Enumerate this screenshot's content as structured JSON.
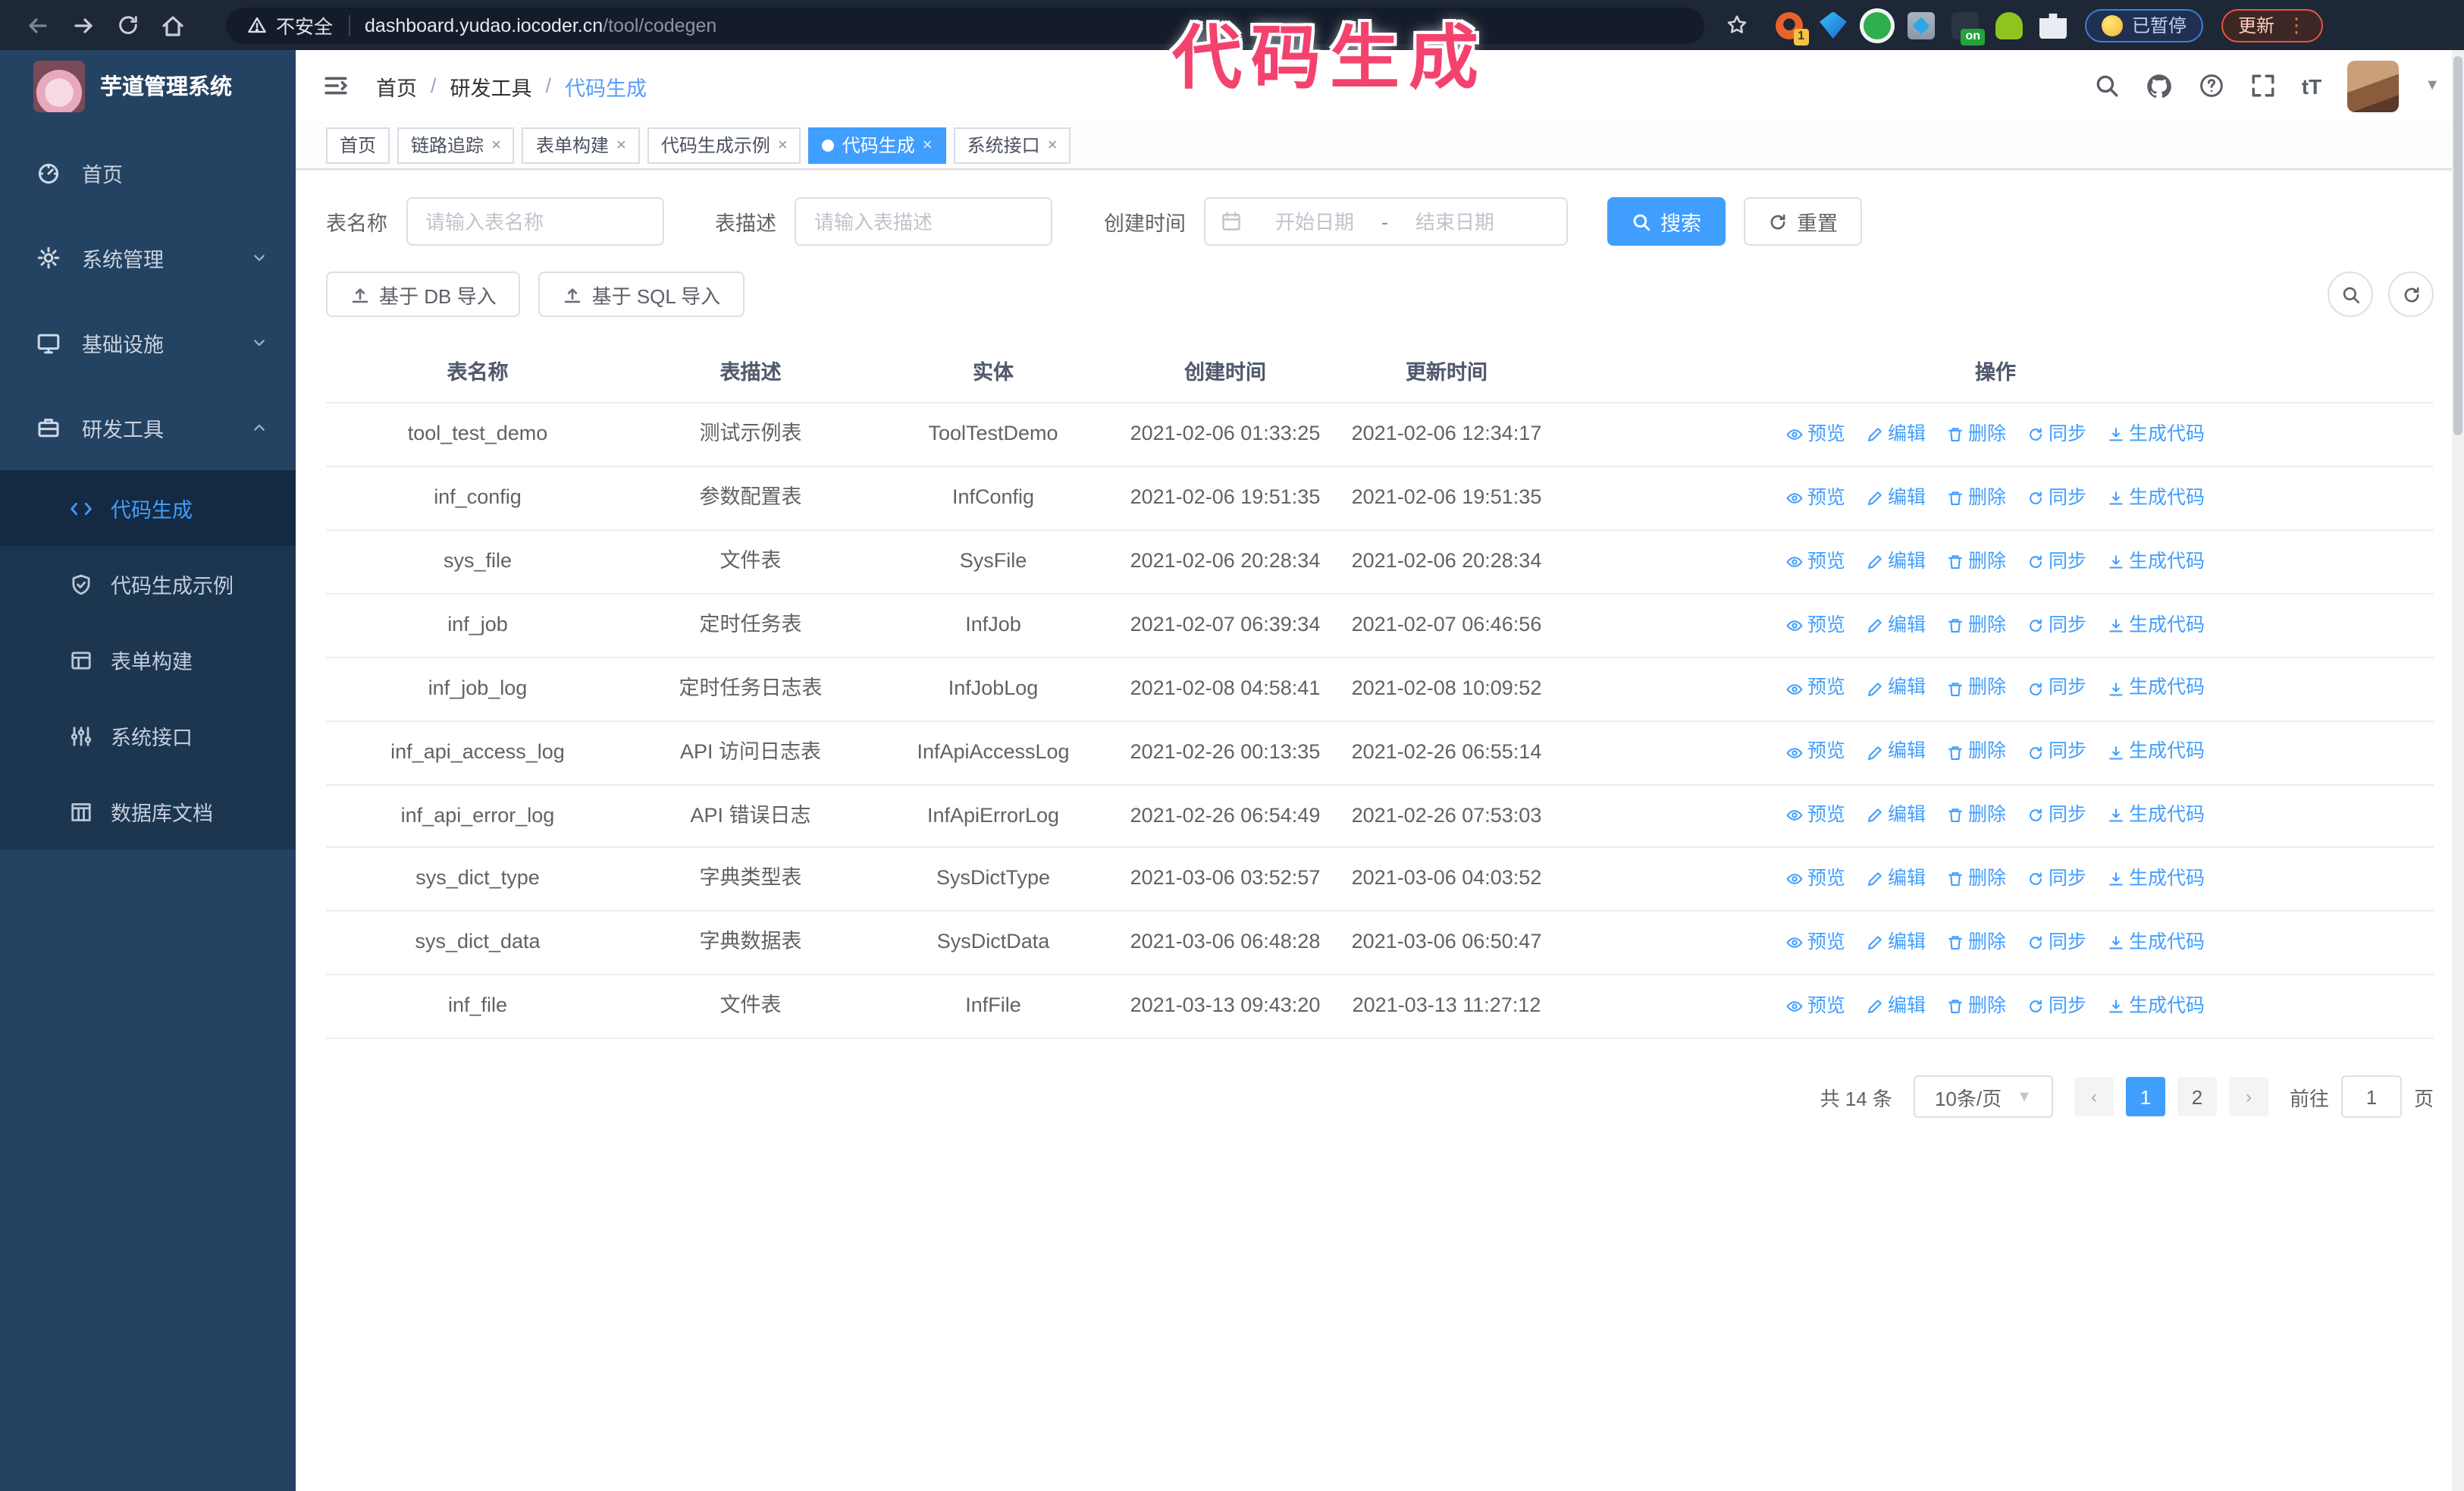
{
  "browser": {
    "security_label": "不安全",
    "url_host": "dashboard.yudao.iocoder.cn",
    "url_path": "/tool/codegen",
    "extensions": [
      {
        "badge": "1"
      },
      {
        "badge": ""
      },
      {
        "badge": ""
      },
      {
        "badge": ""
      },
      {
        "badge": "on"
      },
      {
        "badge": ""
      },
      {
        "badge": ""
      }
    ],
    "paused_button": "已暂停",
    "update_button": "更新"
  },
  "annotation": {
    "text": "代码生成"
  },
  "sidebar": {
    "title": "芋道管理系统",
    "items": [
      {
        "label": "首页",
        "icon": "dashboard-icon",
        "chevron": ""
      },
      {
        "label": "系统管理",
        "icon": "gear-icon",
        "chevron": "down"
      },
      {
        "label": "基础设施",
        "icon": "monitor-icon",
        "chevron": "down"
      },
      {
        "label": "研发工具",
        "icon": "toolbox-icon",
        "chevron": "up"
      }
    ],
    "submenu": [
      {
        "label": "代码生成",
        "icon": "code-icon",
        "active": true
      },
      {
        "label": "代码生成示例",
        "icon": "shield-check-icon",
        "active": false
      },
      {
        "label": "表单构建",
        "icon": "form-icon",
        "active": false
      },
      {
        "label": "系统接口",
        "icon": "sliders-icon",
        "active": false
      },
      {
        "label": "数据库文档",
        "icon": "columns-icon",
        "active": false
      }
    ]
  },
  "header": {
    "breadcrumb": [
      "首页",
      "研发工具",
      "代码生成"
    ]
  },
  "tabs": [
    {
      "label": "首页",
      "closable": false,
      "active": false
    },
    {
      "label": "链路追踪",
      "closable": true,
      "active": false
    },
    {
      "label": "表单构建",
      "closable": true,
      "active": false
    },
    {
      "label": "代码生成示例",
      "closable": true,
      "active": false
    },
    {
      "label": "代码生成",
      "closable": true,
      "active": true
    },
    {
      "label": "系统接口",
      "closable": true,
      "active": false
    }
  ],
  "filters": {
    "table_name_label": "表名称",
    "table_name_placeholder": "请输入表名称",
    "table_desc_label": "表描述",
    "table_desc_placeholder": "请输入表描述",
    "create_time_label": "创建时间",
    "date_start_placeholder": "开始日期",
    "date_separator": "-",
    "date_end_placeholder": "结束日期",
    "search_label": "搜索",
    "reset_label": "重置"
  },
  "toolbar": {
    "import_db_label": "基于 DB 导入",
    "import_sql_label": "基于 SQL 导入"
  },
  "table": {
    "columns": [
      "表名称",
      "表描述",
      "实体",
      "创建时间",
      "更新时间",
      "操作"
    ],
    "actions": [
      {
        "label": "预览",
        "icon": "eye-icon",
        "name": "preview-link"
      },
      {
        "label": "编辑",
        "icon": "pencil-icon",
        "name": "edit-link"
      },
      {
        "label": "删除",
        "icon": "trash-icon",
        "name": "delete-link"
      },
      {
        "label": "同步",
        "icon": "sync-icon",
        "name": "sync-link"
      },
      {
        "label": "生成代码",
        "icon": "download-icon",
        "name": "generate-code-link"
      }
    ],
    "rows": [
      {
        "name": "tool_test_demo",
        "desc": "测试示例表",
        "entity": "ToolTestDemo",
        "created": "2021-02-06 01:33:25",
        "updated": "2021-02-06 12:34:17"
      },
      {
        "name": "inf_config",
        "desc": "参数配置表",
        "entity": "InfConfig",
        "created": "2021-02-06 19:51:35",
        "updated": "2021-02-06 19:51:35"
      },
      {
        "name": "sys_file",
        "desc": "文件表",
        "entity": "SysFile",
        "created": "2021-02-06 20:28:34",
        "updated": "2021-02-06 20:28:34"
      },
      {
        "name": "inf_job",
        "desc": "定时任务表",
        "entity": "InfJob",
        "created": "2021-02-07 06:39:34",
        "updated": "2021-02-07 06:46:56"
      },
      {
        "name": "inf_job_log",
        "desc": "定时任务日志表",
        "entity": "InfJobLog",
        "created": "2021-02-08 04:58:41",
        "updated": "2021-02-08 10:09:52"
      },
      {
        "name": "inf_api_access_log",
        "desc": "API 访问日志表",
        "entity": "InfApiAccessLog",
        "created": "2021-02-26 00:13:35",
        "updated": "2021-02-26 06:55:14"
      },
      {
        "name": "inf_api_error_log",
        "desc": "API 错误日志",
        "entity": "InfApiErrorLog",
        "created": "2021-02-26 06:54:49",
        "updated": "2021-02-26 07:53:03"
      },
      {
        "name": "sys_dict_type",
        "desc": "字典类型表",
        "entity": "SysDictType",
        "created": "2021-03-06 03:52:57",
        "updated": "2021-03-06 04:03:52"
      },
      {
        "name": "sys_dict_data",
        "desc": "字典数据表",
        "entity": "SysDictData",
        "created": "2021-03-06 06:48:28",
        "updated": "2021-03-06 06:50:47"
      },
      {
        "name": "inf_file",
        "desc": "文件表",
        "entity": "InfFile",
        "created": "2021-03-13 09:43:20",
        "updated": "2021-03-13 11:27:12"
      }
    ]
  },
  "pagination": {
    "total_label": "共 14 条",
    "page_size_label": "10条/页",
    "pages": [
      "1",
      "2"
    ],
    "active_page": "1",
    "prev_label": "‹",
    "next_label": "›",
    "goto_label": "前往",
    "goto_value": "1",
    "goto_suffix": "页"
  }
}
